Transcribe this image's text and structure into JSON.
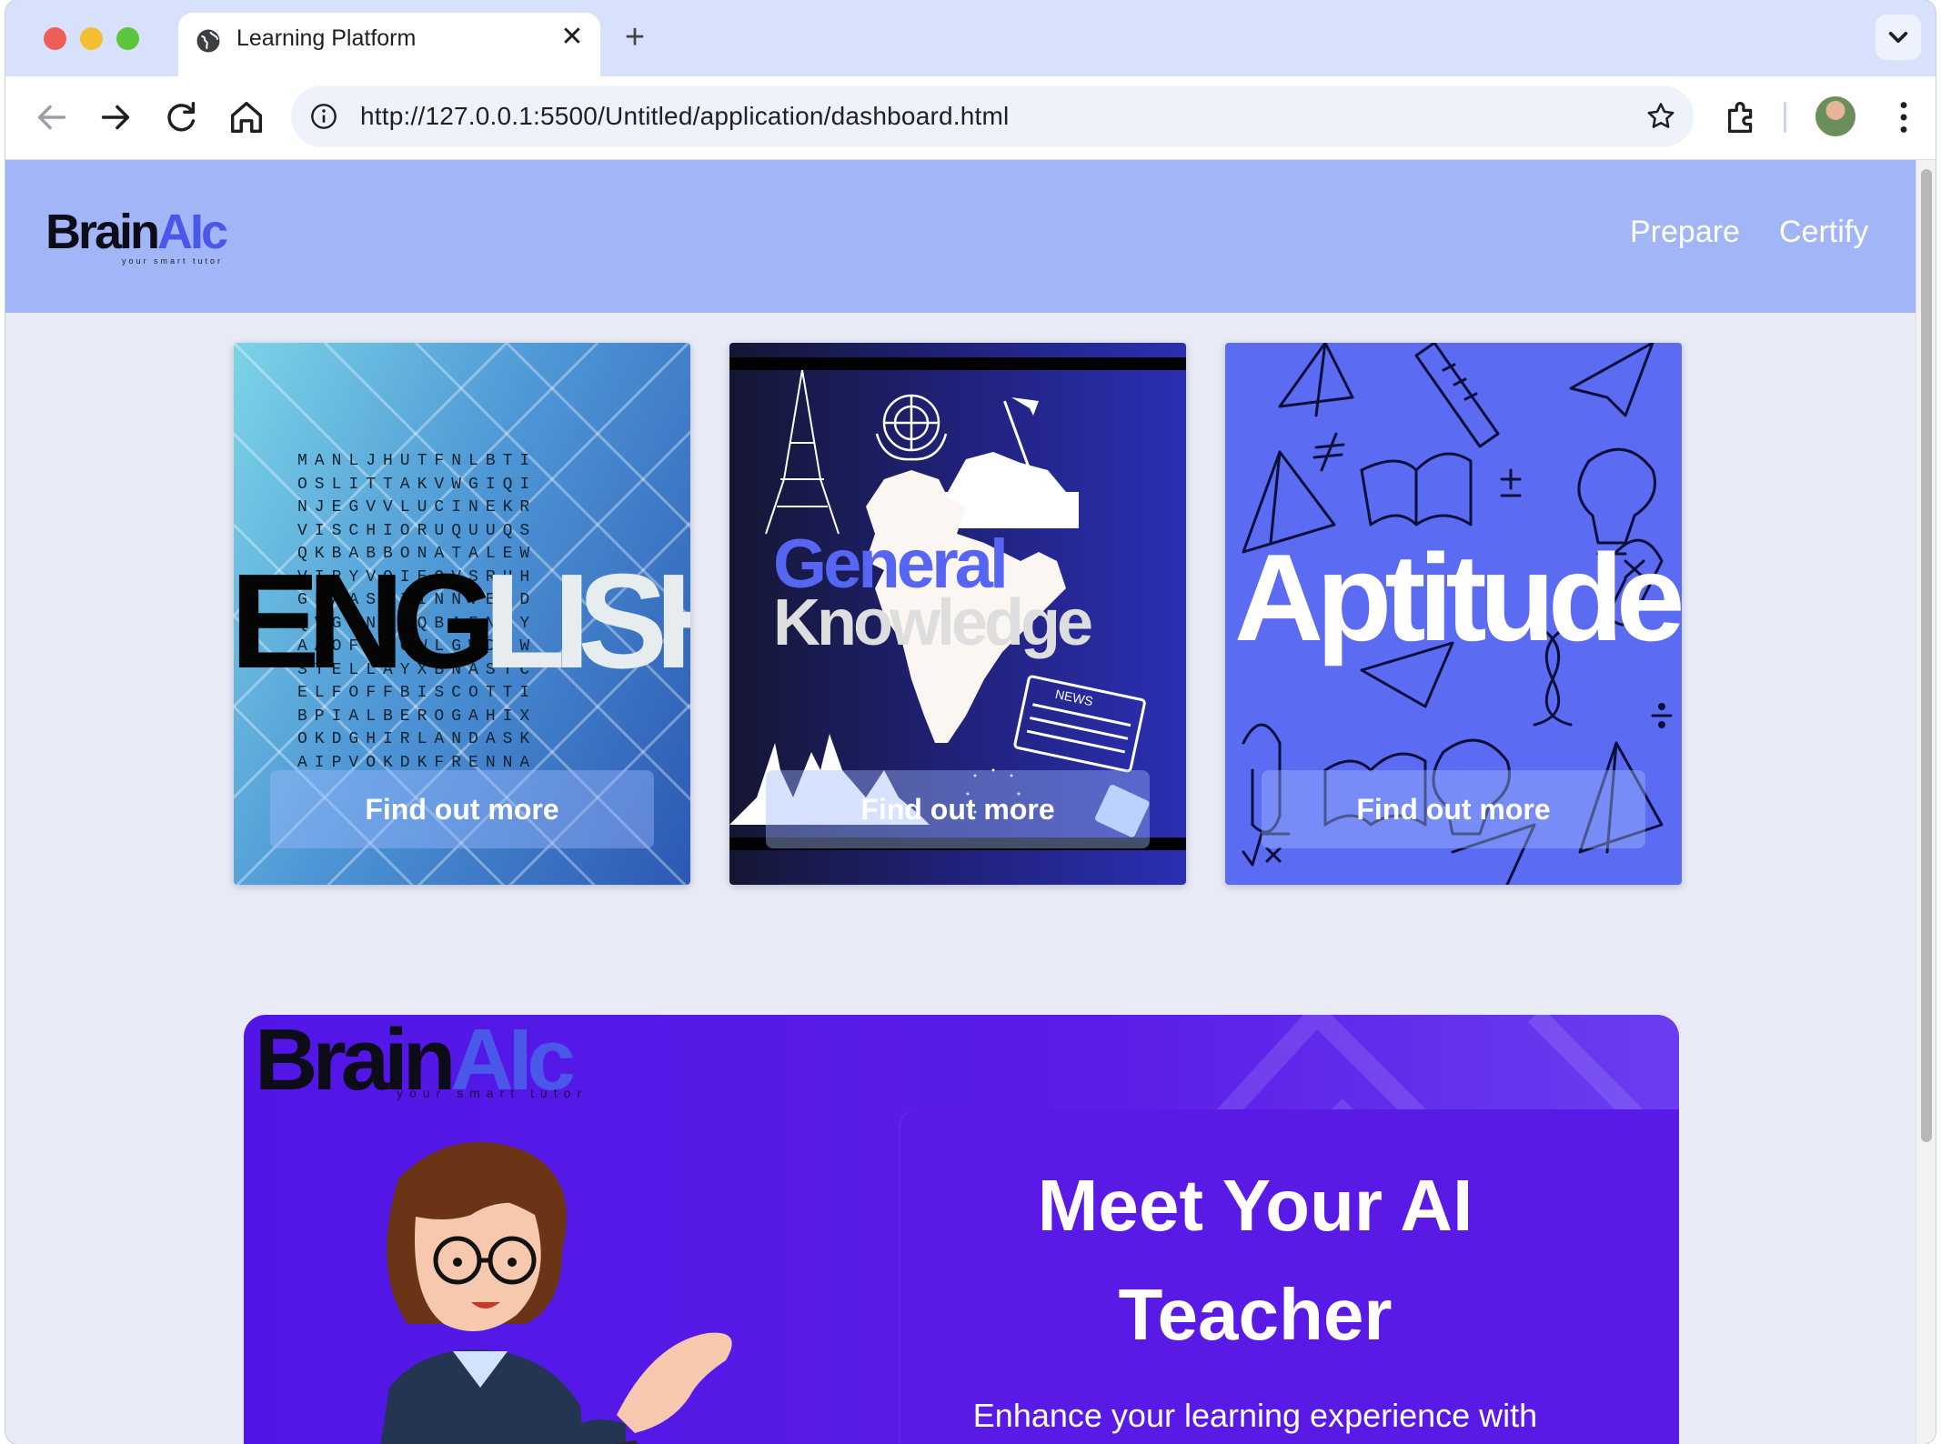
{
  "browser": {
    "tab_title": "Learning Platform",
    "url": "http://127.0.0.1:5500/Untitled/application/dashboard.html"
  },
  "site": {
    "logo": {
      "brain": "Brain",
      "ai": "AIc",
      "tagline": "your smart tutor"
    },
    "nav": [
      {
        "label": "Prepare"
      },
      {
        "label": "Certify"
      }
    ]
  },
  "cards": [
    {
      "title_dark": "ENG",
      "title_light": "LISH",
      "cta": "Find out more",
      "wordsearch": "MANLJHUTFNLBTI\nOSLITTAKVWGIQI\nNJEGVVLUCINEKR\nVISCHIORUQUUQS\nQKBABBONATALEW\nVIPYVOIEQVSRHH\nGFAASTIINNVEKD\nQVGSNDCQBAFNFY\nAAOFVSOWLGWDHW\nSTELLAYXBNASTC\nELFOFFBISCOTTI\nBPIALBEROGAHIX\nOKDGHIRLANDASK\nAIPVOKDKFRENNA"
    },
    {
      "title_top": "General",
      "title_bottom": "Knowledge",
      "badge": "NEWS",
      "cta": "Find out more"
    },
    {
      "title": "Aptitude",
      "cta": "Find out more"
    }
  ],
  "hero": {
    "logo": {
      "brain": "Brain",
      "ai": "AIc",
      "tagline": "your smart tutor"
    },
    "title": "Meet Your AI Teacher",
    "subtitle": "Enhance your learning experience with"
  },
  "colors": {
    "header_bg": "#a2b6f7",
    "page_bg": "#e8ebf6",
    "brand_blue": "#4a58ea",
    "hero_purple": "#5116e6"
  }
}
